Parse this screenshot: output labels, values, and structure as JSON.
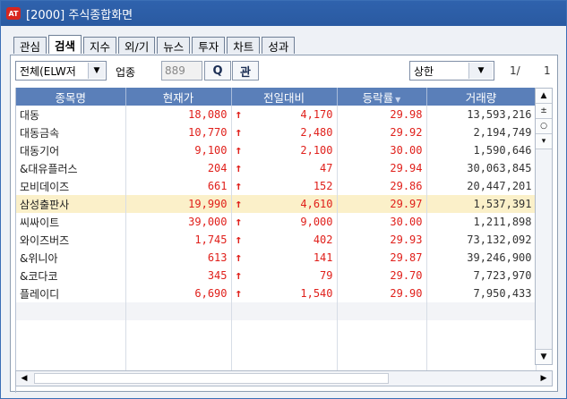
{
  "window": {
    "title": "[2000] 주식종합화면",
    "logo_text": "AT"
  },
  "tabs": [
    "관심",
    "검색",
    "지수",
    "외/기",
    "뉴스",
    "투자",
    "차트",
    "성과"
  ],
  "active_tab": "검색",
  "toolbar": {
    "market_select": "전체(ELW저",
    "sector_label": "업종",
    "sector_code": "889",
    "search_icon": "magnifier",
    "search_button_glyph": "Q",
    "query_button": "관",
    "filter_select": "상한",
    "page_current": "1/",
    "page_total": "1"
  },
  "columns": [
    "종목명",
    "현재가",
    "전일대비",
    "등락률",
    "거래량"
  ],
  "sort_column": "등락률",
  "rows": [
    {
      "name": "대동",
      "price": "18,080",
      "change": "4,170",
      "rate": "29.98",
      "volume": "13,593,216",
      "highlight": false
    },
    {
      "name": "대동금속",
      "price": "10,770",
      "change": "2,480",
      "rate": "29.92",
      "volume": "2,194,749",
      "highlight": false
    },
    {
      "name": "대동기어",
      "price": "9,100",
      "change": "2,100",
      "rate": "30.00",
      "volume": "1,590,646",
      "highlight": false
    },
    {
      "name": "&대유플러스",
      "price": "204",
      "change": "47",
      "rate": "29.94",
      "volume": "30,063,845",
      "highlight": false
    },
    {
      "name": "모비데이즈",
      "price": "661",
      "change": "152",
      "rate": "29.86",
      "volume": "20,447,201",
      "highlight": false
    },
    {
      "name": "삼성출판사",
      "price": "19,990",
      "change": "4,610",
      "rate": "29.97",
      "volume": "1,537,391",
      "highlight": true
    },
    {
      "name": "씨싸이트",
      "price": "39,000",
      "change": "9,000",
      "rate": "30.00",
      "volume": "1,211,898",
      "highlight": false
    },
    {
      "name": "와이즈버즈",
      "price": "1,745",
      "change": "402",
      "rate": "29.93",
      "volume": "73,132,092",
      "highlight": false
    },
    {
      "name": "&위니아",
      "price": "613",
      "change": "141",
      "rate": "29.87",
      "volume": "39,246,900",
      "highlight": false
    },
    {
      "name": "&코다코",
      "price": "345",
      "change": "79",
      "rate": "29.70",
      "volume": "7,723,970",
      "highlight": false
    },
    {
      "name": "플레이디",
      "price": "6,690",
      "change": "1,540",
      "rate": "29.90",
      "volume": "7,950,433",
      "highlight": false
    }
  ],
  "arrow_glyph": "↑",
  "colors": {
    "up": "#e0201b",
    "header": "#5a7fb9",
    "highlight": "#fbf0c9",
    "titlebar": "#2f62ad"
  }
}
